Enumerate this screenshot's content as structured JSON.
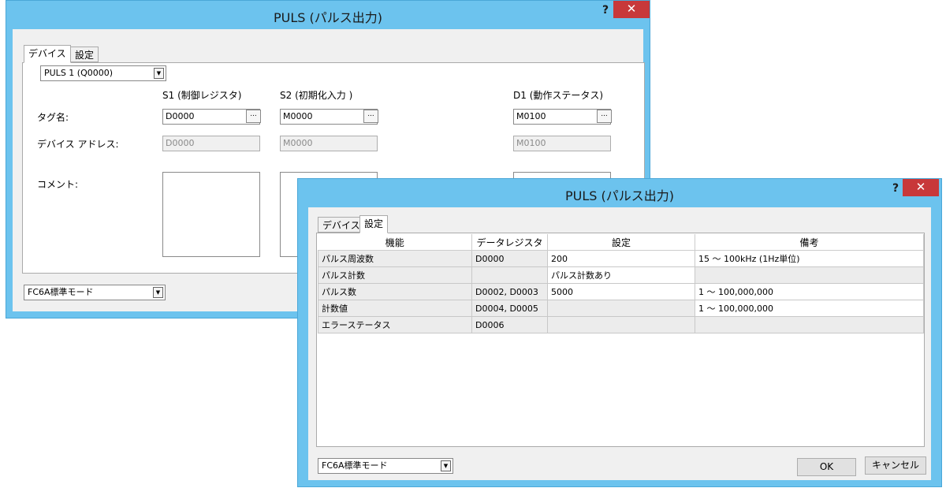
{
  "win1": {
    "title": "PULS (パルス出力)",
    "help": "?",
    "close": "✕",
    "tabs": [
      "デバイス",
      "設定"
    ],
    "device_select": "PULS 1 (Q0000)",
    "labels": {
      "tag": "タグ名:",
      "address": "デバイス アドレス:",
      "comment": "コメント:"
    },
    "columns": [
      {
        "header": "S1 (制御レジスタ)",
        "tag": "D0000",
        "address": "D0000"
      },
      {
        "header": "S2 (初期化入力 )",
        "tag": "M0000",
        "address": "M0000"
      },
      {
        "header": "D1 (動作ステータス)",
        "tag": "M0100",
        "address": "M0100"
      }
    ],
    "browse": "...",
    "mode": "FC6A標準モード"
  },
  "win2": {
    "title": "PULS (パルス出力)",
    "help": "?",
    "close": "✕",
    "tabs": [
      "デバイス",
      "設定"
    ],
    "table": {
      "headers": [
        "機能",
        "データレジスタ",
        "設定",
        "備考"
      ],
      "rows": [
        [
          "パルス周波数",
          "D0000",
          "200",
          "15 ～ 100kHz (1Hz単位)"
        ],
        [
          "パルス計数",
          "",
          "パルス計数あり",
          ""
        ],
        [
          "パルス数",
          "D0002, D0003",
          "5000",
          "1 ～ 100,000,000"
        ],
        [
          "計数値",
          "D0004, D0005",
          "",
          "1 ～ 100,000,000"
        ],
        [
          "エラーステータス",
          "D0006",
          "",
          ""
        ]
      ]
    },
    "mode": "FC6A標準モード",
    "ok": "OK",
    "cancel": "キャンセル"
  }
}
